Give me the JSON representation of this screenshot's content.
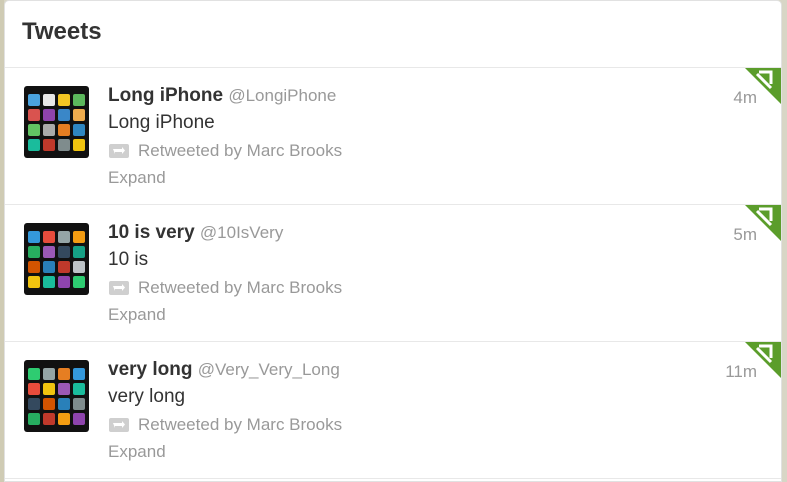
{
  "panel": {
    "title": "Tweets"
  },
  "tweets": [
    {
      "fullname": "Long iPhone",
      "username": "@LongiPhone",
      "text": "Long iPhone",
      "retweeted_by": "Retweeted by Marc Brooks",
      "expand": "Expand",
      "time": "4m"
    },
    {
      "fullname": "10 is very",
      "username": "@10IsVery",
      "text": "10 is",
      "retweeted_by": "Retweeted by Marc Brooks",
      "expand": "Expand",
      "time": "5m"
    },
    {
      "fullname": "very long",
      "username": "@Very_Very_Long",
      "text": "very long",
      "retweeted_by": "Retweeted by Marc Brooks",
      "expand": "Expand",
      "time": "11m"
    }
  ],
  "icons": {
    "retweet": "retweet-icon",
    "corner": "retweet-corner-badge-icon"
  },
  "colors": {
    "accent_green": "#5b9d2b",
    "muted_text": "#999999",
    "primary_text": "#333333"
  }
}
